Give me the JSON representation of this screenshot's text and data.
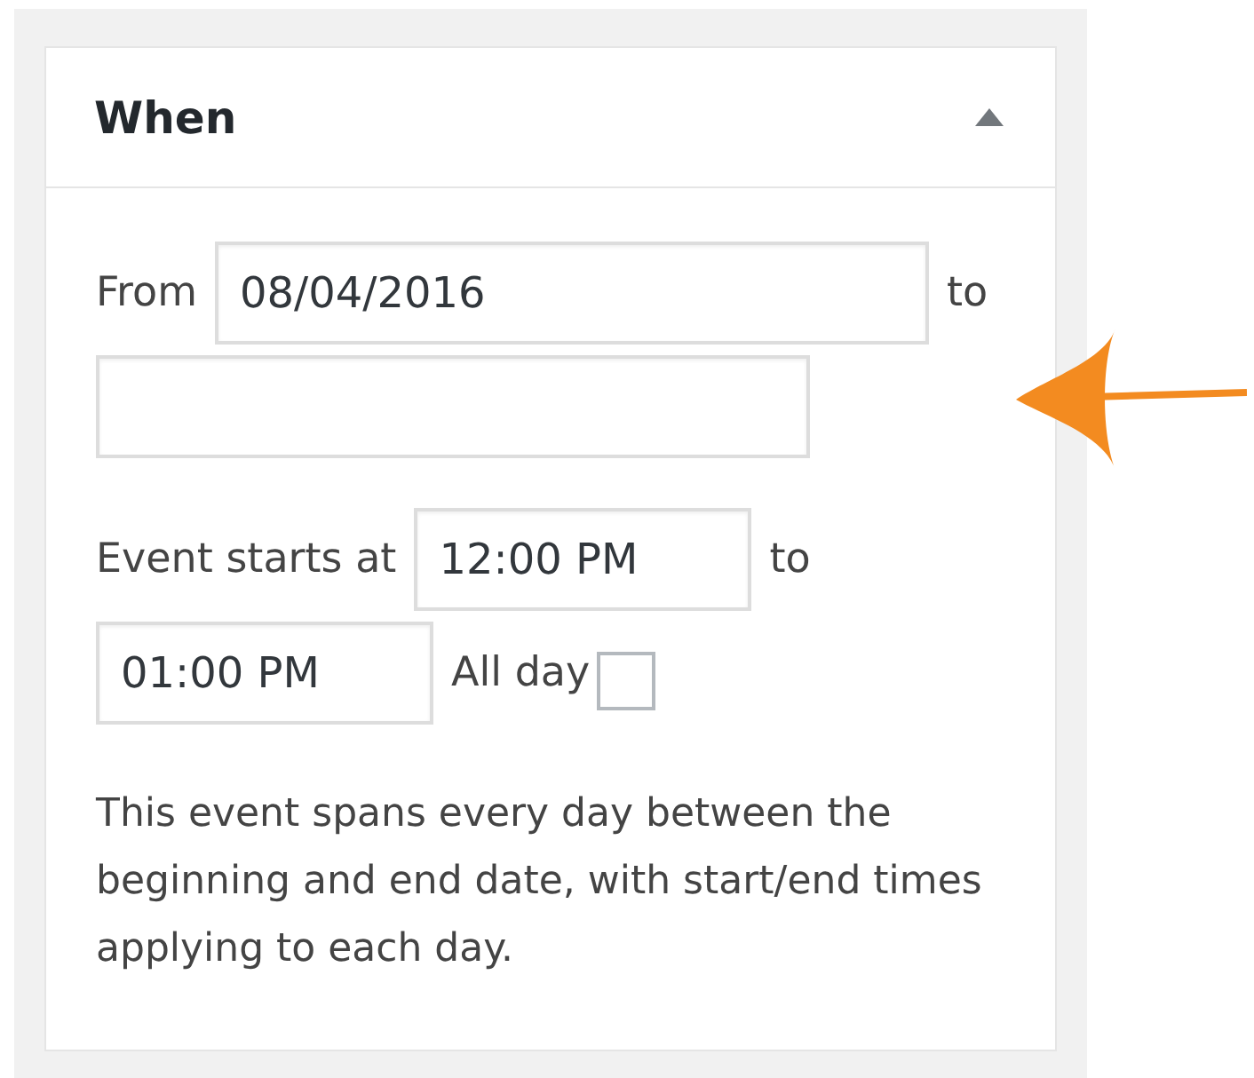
{
  "panel": {
    "title": "When",
    "expanded": true
  },
  "date_row": {
    "label": "From",
    "start_date": "08/04/2016",
    "separator": "to"
  },
  "time_row": {
    "label": "Event starts at",
    "start_time": "12:00 PM",
    "separator": "to",
    "end_time": "01:00 PM"
  },
  "all_day": {
    "label": "All day",
    "checked": false
  },
  "description": "This event spans every day between the beginning and end date, with start/end times applying to each day."
}
